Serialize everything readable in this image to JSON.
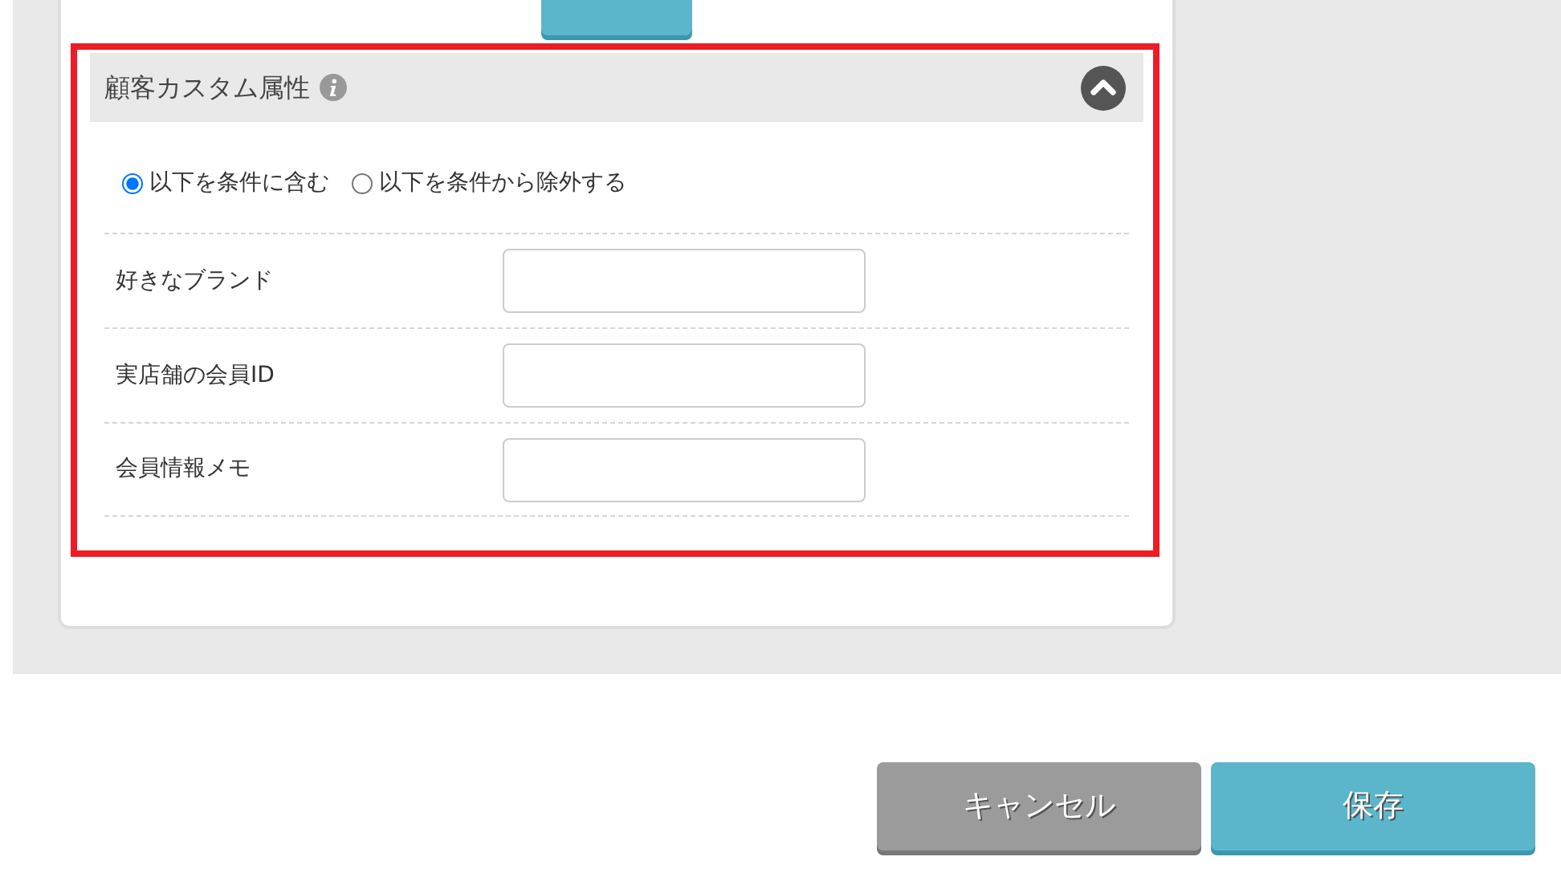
{
  "section": {
    "title": "顧客カスタム属性",
    "expanded": true,
    "highlighted": true,
    "condition_options": [
      {
        "label": "以下を条件に含む",
        "selected": true
      },
      {
        "label": "以下を条件から除外する",
        "selected": false
      }
    ],
    "fields": [
      {
        "label": "好きなブランド"
      },
      {
        "label": "実店舗の会員ID"
      },
      {
        "label": "会員情報メモ"
      }
    ]
  },
  "buttons": [
    {
      "label": "キャンセル",
      "kind": "cancel"
    },
    {
      "label": "保存",
      "kind": "save"
    }
  ]
}
